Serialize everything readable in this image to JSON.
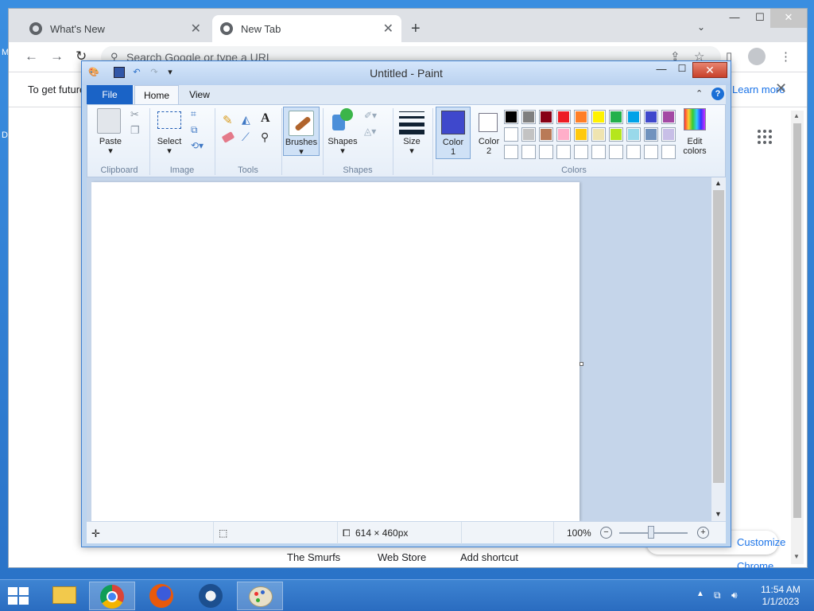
{
  "desktop": {
    "frag_m": "M",
    "frag_d": "D"
  },
  "chrome": {
    "tabs": [
      {
        "label": "What's New"
      },
      {
        "label": "New Tab"
      }
    ],
    "new_tab": "+",
    "tab_search": "⌄",
    "win_min": "—",
    "win_max": "☐",
    "win_close": "✕",
    "back": "←",
    "forward": "→",
    "reload": "↻",
    "omnibox_placeholder": "Search Google or type a URL",
    "infobar": {
      "text": "To get future Google Chrome updates, you'll need Windows 10 or later.",
      "link": "Learn more",
      "close": "✕"
    },
    "shortcuts": [
      "The Smurfs",
      "Web Store",
      "Add shortcut"
    ],
    "customize_label": "Customize Chrome"
  },
  "paint": {
    "title": "Untitled - Paint",
    "min": "—",
    "max": "☐",
    "close": "✕",
    "tabs": {
      "file": "File",
      "home": "Home",
      "view": "View"
    },
    "groups": {
      "clipboard": "Clipboard",
      "image": "Image",
      "tools": "Tools",
      "shapes": "Shapes",
      "colors": "Colors"
    },
    "buttons": {
      "paste": "Paste",
      "select": "Select",
      "brushes": "Brushes",
      "shapes": "Shapes",
      "size": "Size",
      "color1": "Color\n1",
      "color2": "Color\n2",
      "edit_colors": "Edit\ncolors"
    },
    "color1_value": "#3f48cc",
    "color2_value": "#ffffff",
    "palette_row1": [
      "#000000",
      "#7f7f7f",
      "#880015",
      "#ed1c24",
      "#ff7f27",
      "#fff200",
      "#22b14c",
      "#00a2e8",
      "#3f48cc",
      "#a349a4"
    ],
    "palette_row2": [
      "#ffffff",
      "#c3c3c3",
      "#b97a57",
      "#ffaec9",
      "#ffc90e",
      "#efe4b0",
      "#b5e61d",
      "#99d9ea",
      "#7092be",
      "#c8bfe7"
    ],
    "palette_row3": [
      "#ffffff",
      "#ffffff",
      "#ffffff",
      "#ffffff",
      "#ffffff",
      "#ffffff",
      "#ffffff",
      "#ffffff",
      "#ffffff",
      "#ffffff"
    ],
    "status": {
      "canvas_size": "614 × 460px",
      "zoom": "100%"
    }
  },
  "taskbar": {
    "time": "11:54 AM",
    "date": "1/1/2023"
  }
}
